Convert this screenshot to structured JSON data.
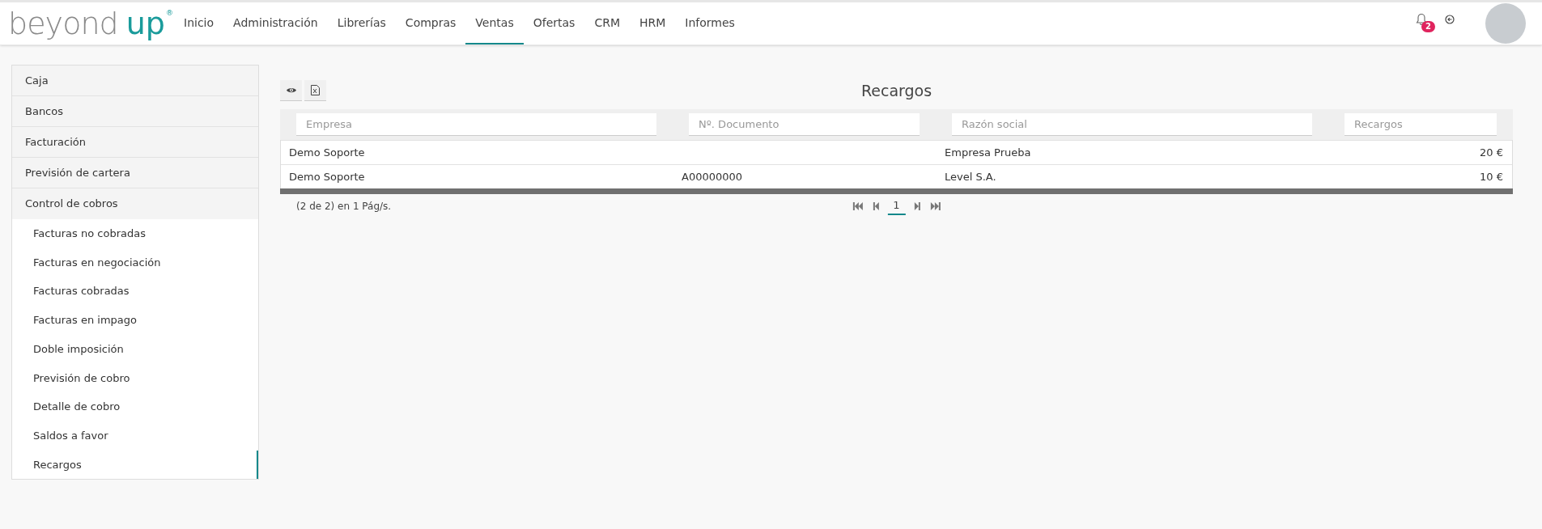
{
  "header": {
    "logo": {
      "part_1": "beyond",
      "part_2": "up",
      "mark": "®"
    },
    "nav": [
      {
        "label": "Inicio",
        "selected": false
      },
      {
        "label": "Administración",
        "selected": false
      },
      {
        "label": "Librerías",
        "selected": false
      },
      {
        "label": "Compras",
        "selected": false
      },
      {
        "label": "Ventas",
        "selected": true
      },
      {
        "label": "Ofertas",
        "selected": false
      },
      {
        "label": "CRM",
        "selected": false
      },
      {
        "label": "HRM",
        "selected": false
      },
      {
        "label": "Informes",
        "selected": false
      }
    ],
    "notifications": {
      "count": "2"
    }
  },
  "sidebar": {
    "items": [
      {
        "label": "Caja",
        "expanded": false
      },
      {
        "label": "Bancos",
        "expanded": false
      },
      {
        "label": "Facturación",
        "expanded": false
      },
      {
        "label": "Previsión de cartera",
        "expanded": false
      },
      {
        "label": "Control de cobros",
        "expanded": true,
        "children": [
          {
            "label": "Facturas no cobradas",
            "selected": false
          },
          {
            "label": "Facturas en negociación",
            "selected": false
          },
          {
            "label": "Facturas cobradas",
            "selected": false
          },
          {
            "label": "Facturas en impago",
            "selected": false
          },
          {
            "label": "Doble imposición",
            "selected": false
          },
          {
            "label": "Previsión de cobro",
            "selected": false
          },
          {
            "label": "Detalle de cobro",
            "selected": false
          },
          {
            "label": "Saldos a favor",
            "selected": false
          },
          {
            "label": "Recargos",
            "selected": true
          }
        ]
      }
    ]
  },
  "main": {
    "title": "Recargos",
    "table": {
      "columns": [
        {
          "placeholder": "Empresa",
          "kind": "text"
        },
        {
          "placeholder": "Nº. Documento",
          "kind": "text"
        },
        {
          "placeholder": "Razón social",
          "kind": "text"
        },
        {
          "placeholder": "Recargos",
          "kind": "amount"
        }
      ],
      "rows": [
        [
          "Demo Soporte",
          "",
          "Empresa Prueba",
          "20 €"
        ],
        [
          "Demo Soporte",
          "A00000000",
          "Level S.A.",
          "10 €"
        ]
      ]
    },
    "pagination": {
      "summary": "(2 de 2) en 1 Pág/s.",
      "pages": [
        {
          "label": "1",
          "selected": true
        }
      ]
    }
  }
}
